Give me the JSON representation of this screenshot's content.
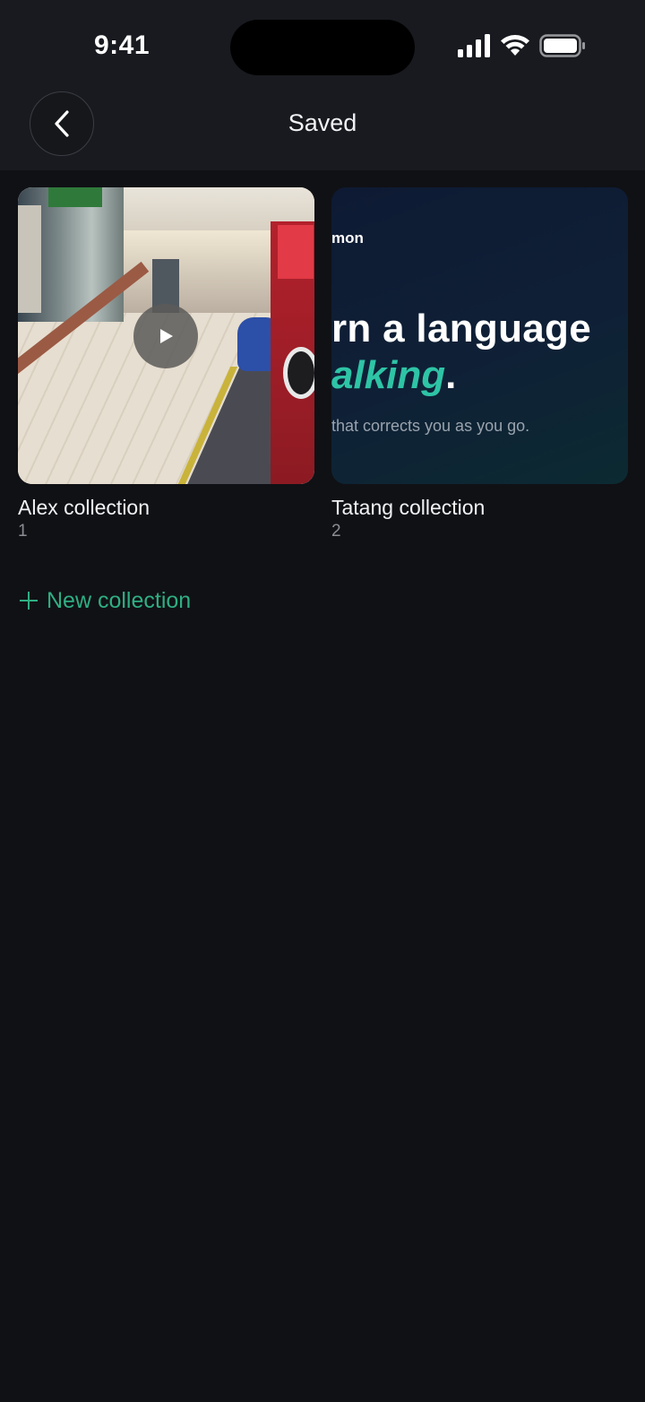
{
  "status_bar": {
    "time": "9:41",
    "icons": [
      "signal-icon",
      "wifi-icon",
      "battery-icon"
    ]
  },
  "header": {
    "title": "Saved",
    "back_icon": "chevron-left-icon"
  },
  "collections": [
    {
      "title": "Alex collection",
      "count": "1",
      "thumbnail": "video",
      "play_icon": "play-icon"
    },
    {
      "title": "Tatang collection",
      "count": "2",
      "thumbnail": "image",
      "promo": {
        "brand": "mon",
        "headline_1": "rn a language",
        "headline_2": "alking",
        "headline_2_punct": ".",
        "subtitle": "that corrects you as you go."
      }
    }
  ],
  "new_collection": {
    "label": "New collection",
    "icon": "plus-icon"
  },
  "colors": {
    "background": "#101115",
    "header_background": "#181a1f",
    "accent": "#2fae82",
    "promo_accent": "#2ec4a6"
  }
}
